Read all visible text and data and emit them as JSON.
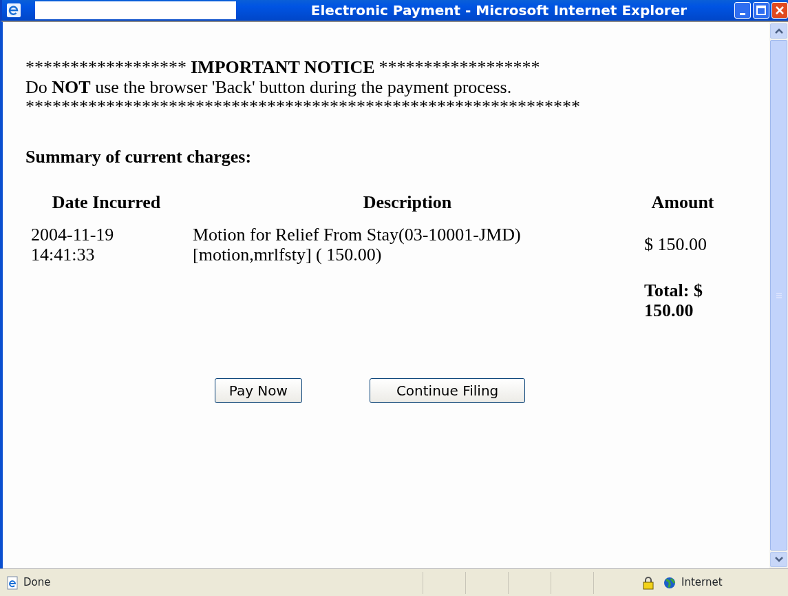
{
  "window": {
    "title": "Electronic Payment - Microsoft Internet Explorer"
  },
  "notice": {
    "stars_left": "******************",
    "heading": "IMPORTANT NOTICE",
    "stars_right": "******************",
    "message": "Do **NOT** use the browser 'Back' button during the payment process.",
    "stars_bottom": "**************************************************************"
  },
  "summary_heading": "Summary of current charges:",
  "table": {
    "columns": [
      "Date Incurred",
      "Description",
      "Amount"
    ],
    "rows": [
      {
        "date": "2004-11-19 14:41:33",
        "description": "Motion for Relief From Stay(03-10001-JMD) [motion,mrlfsty] ( 150.00)",
        "amount": "$ 150.00"
      }
    ],
    "total": "Total: $ 150.00"
  },
  "buttons": [
    "Pay Now",
    "Continue Filing"
  ],
  "status_bar": {
    "text": "Done",
    "zone": "Internet"
  }
}
